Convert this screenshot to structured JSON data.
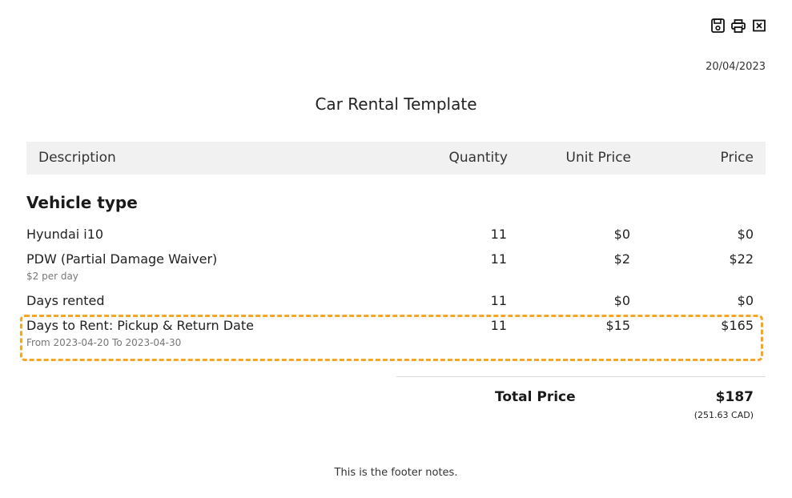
{
  "toolbar": {
    "icons": [
      "save-icon",
      "print-icon",
      "close-icon"
    ]
  },
  "date": "20/04/2023",
  "title": "Car Rental Template",
  "table_header": {
    "description": "Description",
    "quantity": "Quantity",
    "unit_price": "Unit Price",
    "price": "Price"
  },
  "section": {
    "title": "Vehicle type"
  },
  "items": [
    {
      "description": "Hyundai i10",
      "sub": "",
      "quantity": "11",
      "unit_price": "$0",
      "price": "$0"
    },
    {
      "description": "PDW (Partial Damage Waiver)",
      "sub": "$2 per day",
      "quantity": "11",
      "unit_price": "$2",
      "price": "$22"
    },
    {
      "description": "Days rented",
      "sub": "",
      "quantity": "11",
      "unit_price": "$0",
      "price": "$0"
    },
    {
      "description": "Days to Rent: Pickup & Return Date",
      "sub": "From 2023-04-20 To 2023-04-30",
      "quantity": "11",
      "unit_price": "$15",
      "price": "$165"
    }
  ],
  "total": {
    "label": "Total Price",
    "value": "$187",
    "converted": "(251.63 CAD)"
  },
  "footer": "This is the footer notes.",
  "colors": {
    "highlight_border": "#f5a623",
    "header_bg": "#f1f1f1"
  }
}
